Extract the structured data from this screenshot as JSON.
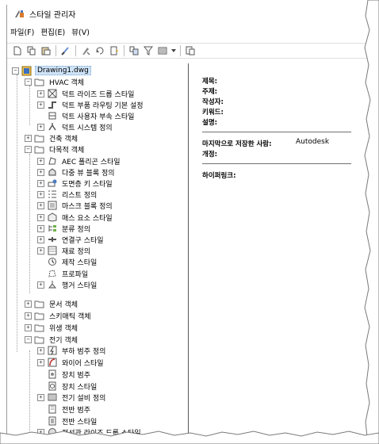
{
  "window": {
    "title": "스타일 관리자"
  },
  "menu": [
    {
      "label": "파일(F)"
    },
    {
      "label": "편집(E)"
    },
    {
      "label": "뷰(V)"
    }
  ],
  "toolbar": [
    "new-icon",
    "copy-icon",
    "paste-icon",
    "purge-icon",
    "edit-icon",
    "set-from-icon",
    "sort-icon",
    "toggle-view-icon",
    "filter-icon",
    "list-icon",
    "help-icon"
  ],
  "tree": {
    "drawing": "Drawing1.dwg",
    "hvac": {
      "label": "HVAC 객체",
      "items": [
        "덕트 라이즈 드롭 스타일",
        "덕트 부품 라우팅 기본 설정",
        "덕트 사용자 부속 스타일",
        "덕트 시스템 정의"
      ]
    },
    "building": "건축 객체",
    "multi": {
      "label": "다목적 객체",
      "items": [
        "AEC 폴리곤 스타일",
        "다중 뷰 블록 정의",
        "도면층 키 스타일",
        "리스트 정의",
        "마스크 블록 정의",
        "매스 요소 스타일",
        "분류 정의",
        "연결구 스타일",
        "재료 정의",
        "제작 스타일",
        "프로파일",
        "행거 스타일"
      ]
    },
    "doc": "문서 객체",
    "schematic": "스키매틱 객체",
    "sanitary": "위생 객체",
    "electrical": {
      "label": "전기 객체",
      "items": [
        "부하 범주 정의",
        "와이어 스타일",
        "장치 범주",
        "장치 스타일",
        "전기 설비 정의",
        "전반 범주",
        "전반 스타일",
        "전선관 라이즈 드롭 스타일"
      ]
    }
  },
  "properties": {
    "title_label": "제목:",
    "subject_label": "주제:",
    "author_label": "작성자:",
    "keywords_label": "키워드:",
    "desc_label": "설명:",
    "saved_by_label": "마지막으로 저장한 사람:",
    "saved_by_value": "Autodesk",
    "revision_label": "개정:",
    "hyperlink_label": "하이퍼링크:"
  }
}
